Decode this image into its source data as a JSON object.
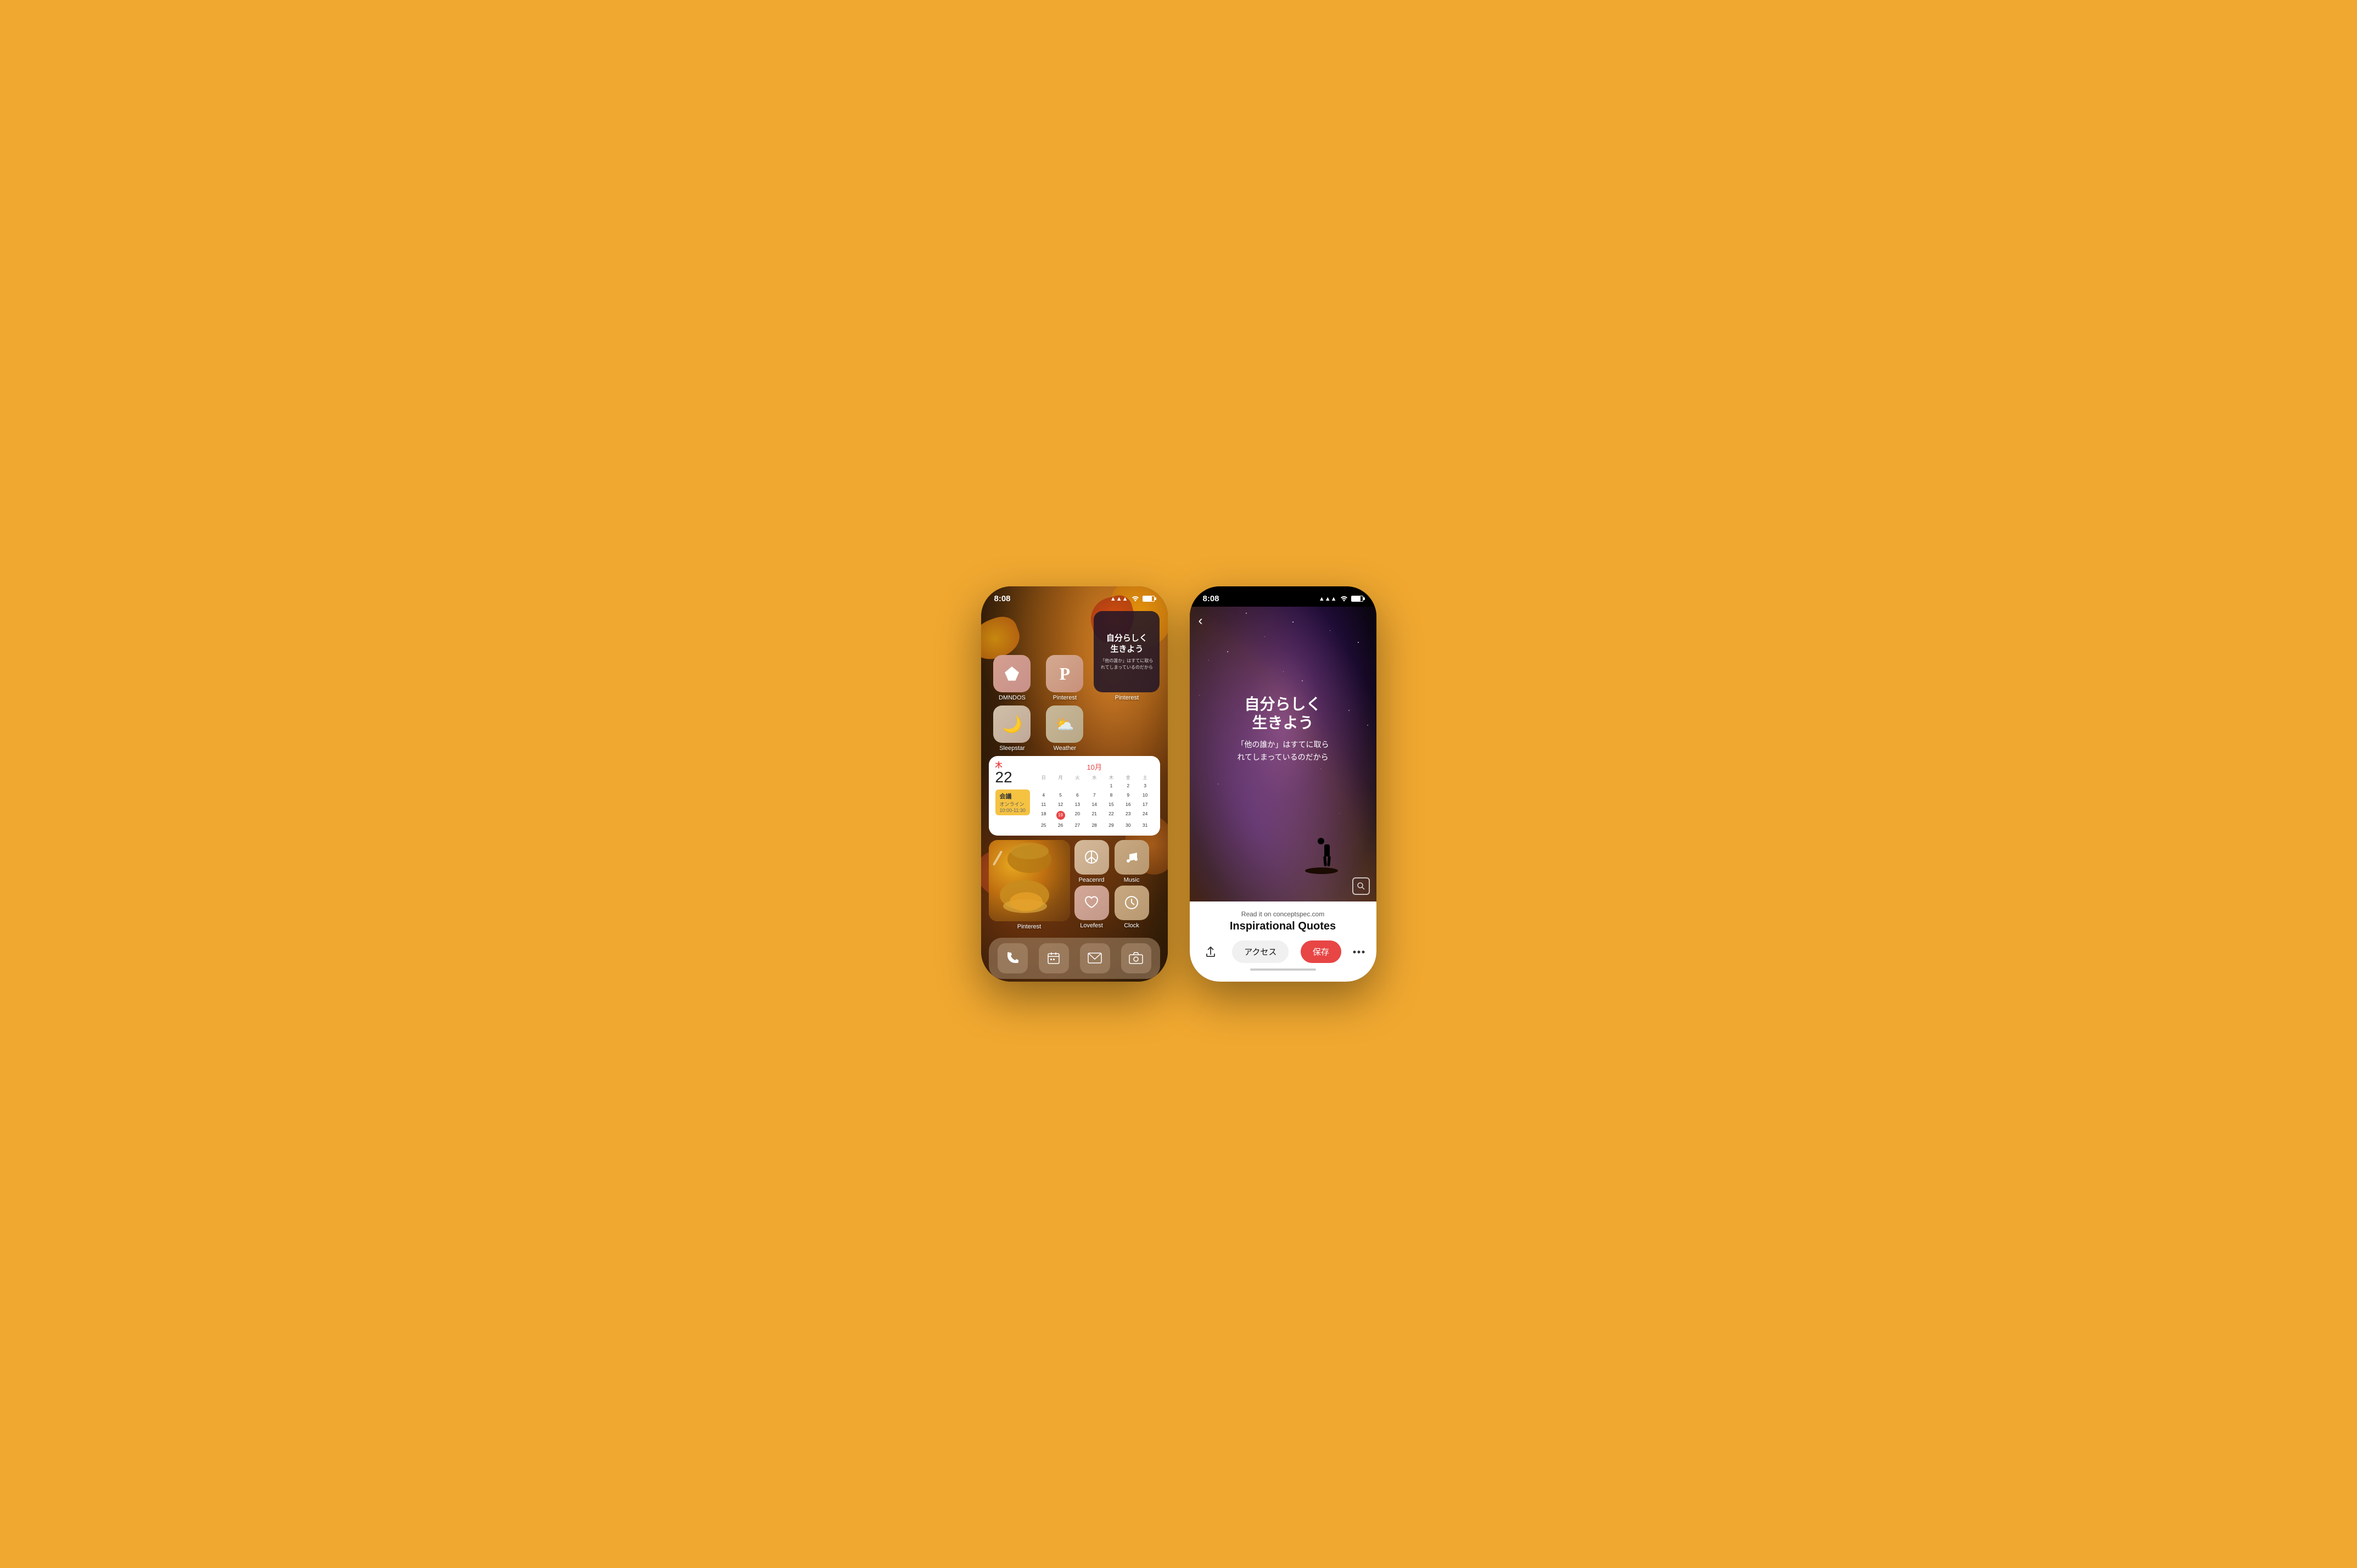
{
  "background": "#F0A830",
  "left_phone": {
    "status_bar": {
      "time": "8:08",
      "signal": "▲▲▲",
      "wifi": "wifi",
      "battery": "battery"
    },
    "apps_row1": [
      {
        "id": "dmndos",
        "label": "DMNDOS",
        "icon": "◇",
        "bg": "bg-pink"
      },
      {
        "id": "pinterest1",
        "label": "Pinterest",
        "icon": "P",
        "bg": "bg-peach"
      }
    ],
    "quote_widget": {
      "main": "自分らしく\n生きよう",
      "sub": "「他の誰か」はすてに取られてしまっているのだから"
    },
    "apps_row2": [
      {
        "id": "sleepstar",
        "label": "Sleepstar",
        "icon": "☾",
        "bg": "bg-moon"
      },
      {
        "id": "weather",
        "label": "Weather",
        "icon": "☁",
        "bg": "bg-weather"
      }
    ],
    "pinterest_big": {
      "label": "Pinterest",
      "icon": "P",
      "bg": "bg-peach"
    },
    "calendar": {
      "day_label": "木",
      "day_number": "22",
      "month": "10月",
      "day_headers": [
        "日",
        "月",
        "火",
        "水",
        "木",
        "金",
        "土"
      ],
      "weeks": [
        [
          "",
          "",
          "",
          "",
          "1",
          "2",
          "3"
        ],
        [
          "4",
          "5",
          "6",
          "7",
          "8",
          "9",
          "10"
        ],
        [
          "11",
          "12",
          "13",
          "14",
          "15",
          "16",
          "17"
        ],
        [
          "18",
          "19",
          "20",
          "21",
          "22",
          "23",
          "24"
        ],
        [
          "25",
          "26",
          "27",
          "28",
          "29",
          "30",
          "31"
        ]
      ],
      "today_date": "19",
      "event": {
        "title": "会議",
        "subtitle": "オンライン",
        "time": "10:00-11:30"
      }
    },
    "bottom_icons": [
      {
        "id": "peacenrd",
        "label": "Peacenrd",
        "icon": "☮",
        "bg": "bg-peace"
      },
      {
        "id": "music",
        "label": "Music",
        "icon": "♪",
        "bg": "bg-music"
      },
      {
        "id": "lovefest",
        "label": "Lovefest",
        "icon": "♡",
        "bg": "bg-love"
      },
      {
        "id": "clock",
        "label": "Clock",
        "icon": "◷",
        "bg": "bg-clock"
      }
    ],
    "pinterest_photo_label": "Pinterest",
    "dock": [
      {
        "id": "phone",
        "icon": "📞"
      },
      {
        "id": "calendar",
        "icon": "📅"
      },
      {
        "id": "mail",
        "icon": "✉"
      },
      {
        "id": "camera",
        "icon": "📷"
      }
    ]
  },
  "right_phone": {
    "status_bar": {
      "time": "8:08"
    },
    "back_label": "‹",
    "quote_main": "自分らしく\n生きよう",
    "quote_sub": "「他の誰か」はすてに取られてしまっているのだから",
    "bottom_panel": {
      "read_it_prefix": "Read it on ",
      "read_it_site": "conceptspec.com",
      "title": "Inspirational Quotes",
      "btn_access": "アクセス",
      "btn_save": "保存",
      "btn_more": "•••"
    }
  }
}
